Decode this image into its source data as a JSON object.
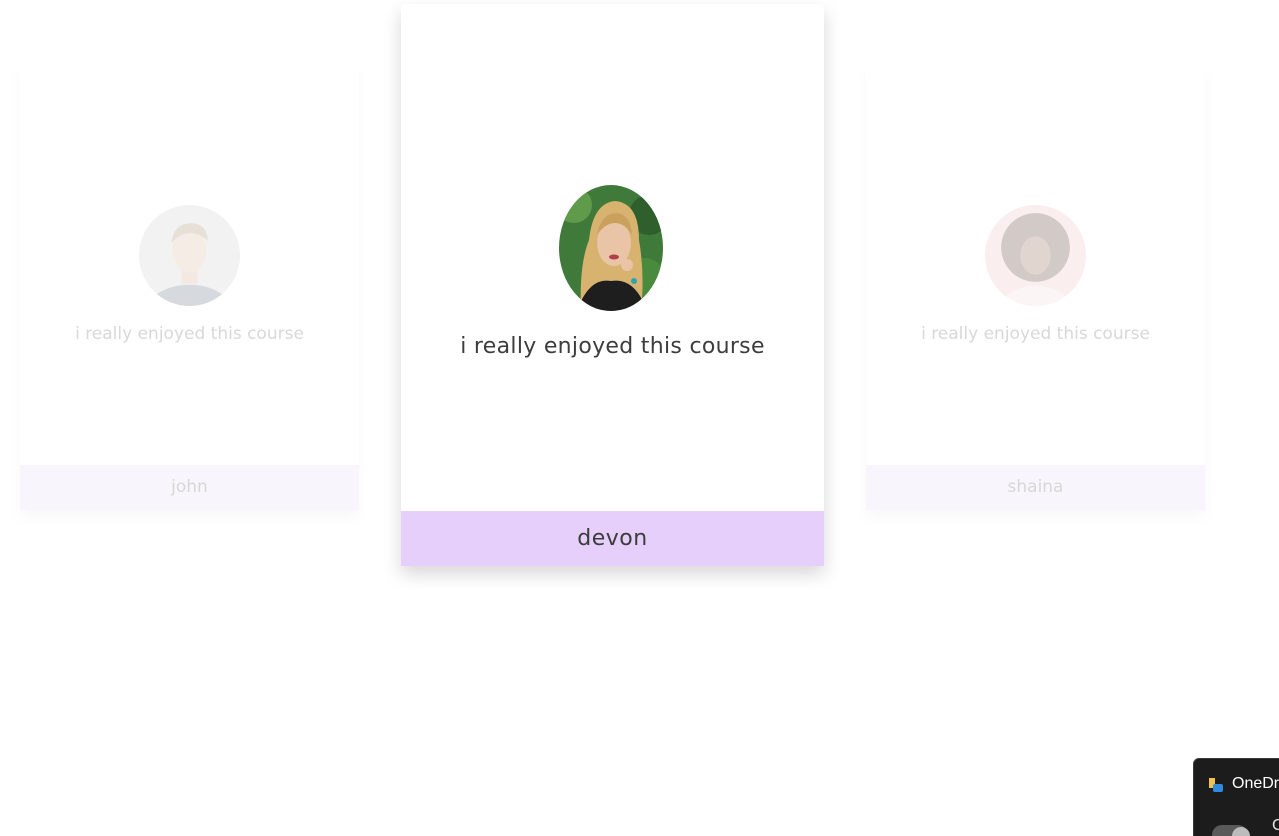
{
  "testimonials": [
    {
      "name": "john",
      "quote": "i really enjoyed this course",
      "avatar_icon": "person-photo-man"
    },
    {
      "name": "devon",
      "quote": "i really enjoyed this course",
      "avatar_icon": "person-photo-woman-blonde"
    },
    {
      "name": "shaina",
      "quote": "i really enjoyed this course",
      "avatar_icon": "person-photo-woman-curly"
    }
  ],
  "colors": {
    "accent_bar_active": "#e6cffb",
    "accent_bar_inactive": "#f5eefc",
    "text_primary": "#3c3c3c",
    "text_faded": "#b8b8b8"
  },
  "onedrive": {
    "label": "OneDrive",
    "sub_label": "C",
    "icon": "onedrive-icon"
  }
}
